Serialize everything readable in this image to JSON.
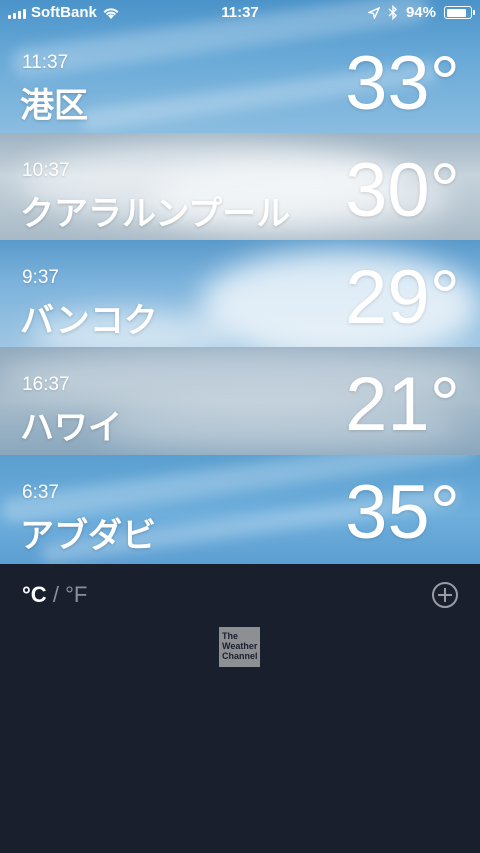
{
  "status_bar": {
    "carrier": "SoftBank",
    "time": "11:37",
    "battery_percent_text": "94%",
    "battery_level": 0.94,
    "icons": [
      "signal-icon",
      "wifi-icon",
      "location-arrow-icon",
      "bluetooth-icon",
      "battery-icon"
    ]
  },
  "cities": [
    {
      "local_time": "11:37",
      "name": "港区",
      "temperature": "33°"
    },
    {
      "local_time": "10:37",
      "name": "クアラルンプール",
      "temperature": "30°"
    },
    {
      "local_time": "9:37",
      "name": "バンコク",
      "temperature": "29°"
    },
    {
      "local_time": "16:37",
      "name": "ハワイ",
      "temperature": "21°"
    },
    {
      "local_time": "6:37",
      "name": "アブダビ",
      "temperature": "35°"
    }
  ],
  "footer": {
    "unit_celsius": "°C",
    "unit_separator": "/",
    "unit_fahrenheit": "°F",
    "add_button_icon": "plus-circle-icon",
    "logo": "The Weather Channel"
  },
  "colors": {
    "panel_background": "#1a1f2e",
    "inactive_text": "#8c8f98"
  }
}
